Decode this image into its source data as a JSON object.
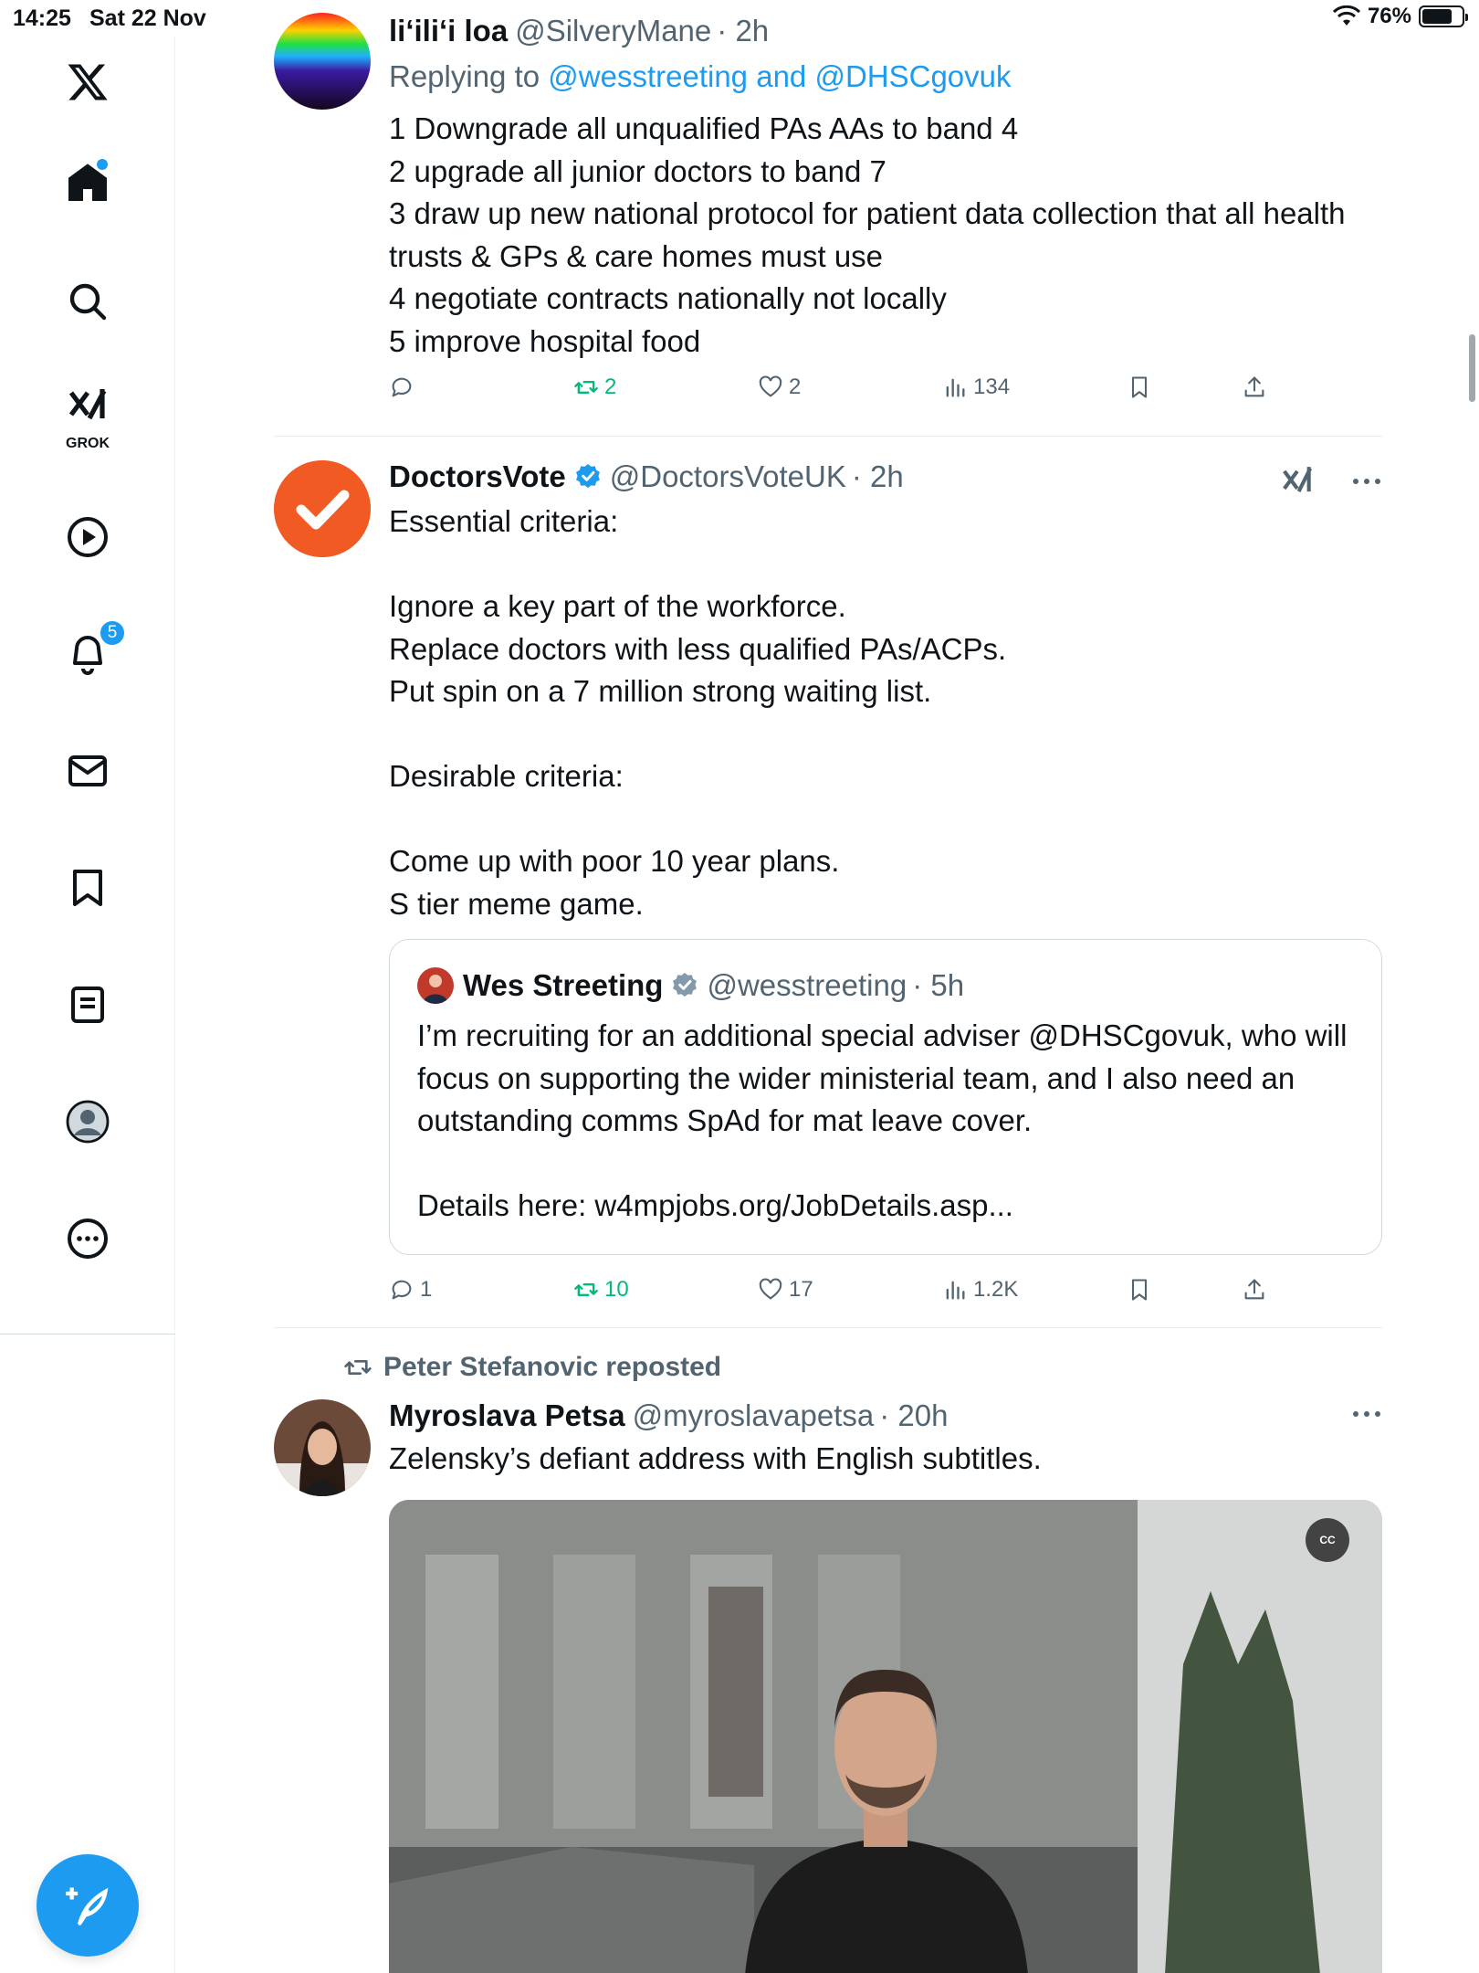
{
  "status_bar": {
    "time": "14:25",
    "date": "Sat 22 Nov",
    "battery": "76%"
  },
  "sidebar": {
    "grok_label": "GROK",
    "notifications_count": "5",
    "items": [
      "x-logo",
      "home",
      "search",
      "grok",
      "videos",
      "notifications",
      "messages",
      "bookmarks",
      "lists",
      "profile",
      "more"
    ]
  },
  "colors": {
    "accent": "#1d9bf0",
    "repost_green": "#00ba7c",
    "muted": "#536471",
    "doctorsvote_orange": "#f15a22"
  },
  "tweets": [
    {
      "name": "liʻiliʻi loa",
      "handle": "@SilveryMane",
      "time": "· 2h",
      "reply_prefix": "Replying to",
      "reply_to_1": "@wesstreeting",
      "reply_and": "and",
      "reply_to_2": "@DHSCgovuk",
      "text": "1 Downgrade all unqualified PAs AAs to band 4\n2 upgrade all junior doctors to band 7\n3 draw up new national protocol for patient data collection that all health trusts & GPs & care homes must use\n4 negotiate contracts nationally not locally\n5 improve hospital food",
      "reposts": "2",
      "likes": "2",
      "views": "134"
    },
    {
      "name": "DoctorsVote",
      "handle": "@DoctorsVoteUK",
      "time": "· 2h",
      "text": "Essential criteria:\n\nIgnore a key part of the workforce.\nReplace doctors with less qualified PAs/ACPs.\nPut spin on a 7 million strong waiting list.\n\nDesirable criteria:\n\nCome up with poor 10 year plans.\nS tier meme game.",
      "quote": {
        "name": "Wes Streeting",
        "handle": "@wesstreeting",
        "time": "· 5h",
        "text": "I’m recruiting for an additional special adviser @DHSCgovuk, who will focus on supporting the wider ministerial team, and I also need an outstanding comms SpAd for mat leave cover.\n\nDetails here: w4mpjobs.org/JobDetails.asp..."
      },
      "replies": "1",
      "reposts": "10",
      "likes": "17",
      "views": "1.2K"
    },
    {
      "reposted_by": "Peter Stefanovic reposted",
      "name": "Myroslava Petsa",
      "handle": "@myroslavapetsa",
      "time": "· 20h",
      "text": "Zelensky’s defiant address with English subtitles.",
      "cc_label": "CC"
    }
  ]
}
